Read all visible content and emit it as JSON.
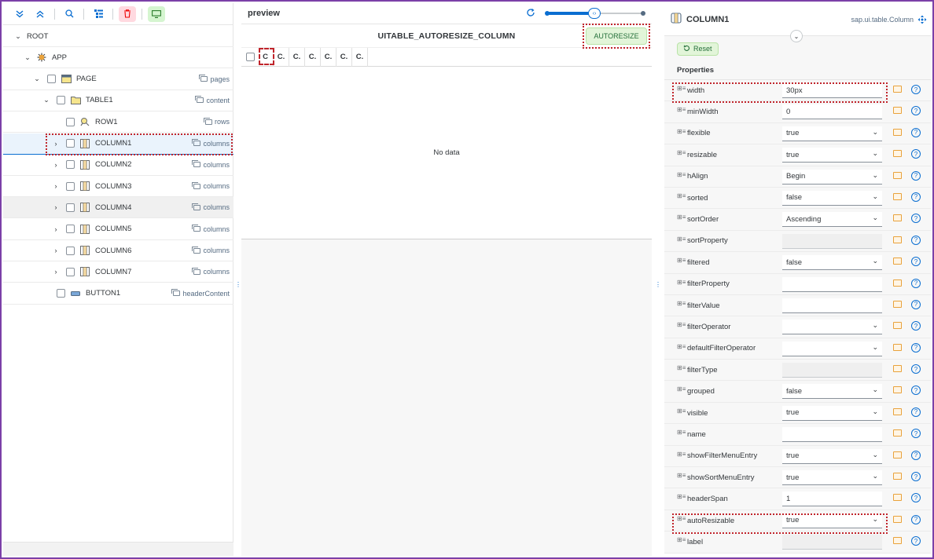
{
  "toolbar": {
    "expand_all_icon": "double-chevron-down-icon",
    "collapse_all_icon": "double-chevron-up-icon",
    "search_icon": "search-icon",
    "tree_icon": "tree-list-icon",
    "delete_icon": "trash-icon",
    "display_icon": "display-icon"
  },
  "tree": [
    {
      "label": "ROOT",
      "agg": "",
      "indent": 0,
      "chevron": "⌄",
      "checkbox": false,
      "icon": "none"
    },
    {
      "label": "APP",
      "agg": "",
      "indent": 1,
      "chevron": "⌄",
      "checkbox": false,
      "icon": "app"
    },
    {
      "label": "PAGE",
      "agg": "pages",
      "indent": 2,
      "chevron": "⌄",
      "checkbox": true,
      "icon": "page"
    },
    {
      "label": "TABLE1",
      "agg": "content",
      "indent": 3,
      "chevron": "⌄",
      "checkbox": true,
      "icon": "folder"
    },
    {
      "label": "ROW1",
      "agg": "rows",
      "indent": 4,
      "chevron": "",
      "checkbox": true,
      "icon": "row"
    },
    {
      "label": "COLUMN1",
      "agg": "columns",
      "indent": 4,
      "chevron": "›",
      "checkbox": true,
      "icon": "column",
      "selected": true
    },
    {
      "label": "COLUMN2",
      "agg": "columns",
      "indent": 4,
      "chevron": "›",
      "checkbox": true,
      "icon": "column"
    },
    {
      "label": "COLUMN3",
      "agg": "columns",
      "indent": 4,
      "chevron": "›",
      "checkbox": true,
      "icon": "column"
    },
    {
      "label": "COLUMN4",
      "agg": "columns",
      "indent": 4,
      "chevron": "›",
      "checkbox": true,
      "icon": "column",
      "hover": true
    },
    {
      "label": "COLUMN5",
      "agg": "columns",
      "indent": 4,
      "chevron": "›",
      "checkbox": true,
      "icon": "column"
    },
    {
      "label": "COLUMN6",
      "agg": "columns",
      "indent": 4,
      "chevron": "›",
      "checkbox": true,
      "icon": "column"
    },
    {
      "label": "COLUMN7",
      "agg": "columns",
      "indent": 4,
      "chevron": "›",
      "checkbox": true,
      "icon": "column"
    },
    {
      "label": "BUTTON1",
      "agg": "headerContent",
      "indent": 3,
      "chevron": "",
      "checkbox": true,
      "icon": "button"
    }
  ],
  "preview": {
    "title": "preview",
    "table_title": "UITABLE_AUTORESIZE_COLUMN",
    "autoresize_label": "AUTORESIZE",
    "columns": [
      "C",
      "C.",
      "C.",
      "C.",
      "C.",
      "C.",
      "C."
    ],
    "no_data": "No data"
  },
  "inspector": {
    "title": "COLUMN1",
    "class_name": "sap.ui.table.Column",
    "reset_label": "Reset",
    "section_title": "Properties",
    "properties": [
      {
        "name": "width",
        "value": "30px",
        "type": "input"
      },
      {
        "name": "minWidth",
        "value": "0",
        "type": "input"
      },
      {
        "name": "flexible",
        "value": "true",
        "type": "select"
      },
      {
        "name": "resizable",
        "value": "true",
        "type": "select"
      },
      {
        "name": "hAlign",
        "value": "Begin",
        "type": "select"
      },
      {
        "name": "sorted",
        "value": "false",
        "type": "select"
      },
      {
        "name": "sortOrder",
        "value": "Ascending",
        "type": "select"
      },
      {
        "name": "sortProperty",
        "value": "",
        "type": "readonly"
      },
      {
        "name": "filtered",
        "value": "false",
        "type": "select"
      },
      {
        "name": "filterProperty",
        "value": "",
        "type": "input"
      },
      {
        "name": "filterValue",
        "value": "",
        "type": "input"
      },
      {
        "name": "filterOperator",
        "value": "",
        "type": "select"
      },
      {
        "name": "defaultFilterOperator",
        "value": "",
        "type": "select"
      },
      {
        "name": "filterType",
        "value": "",
        "type": "readonly"
      },
      {
        "name": "grouped",
        "value": "false",
        "type": "select"
      },
      {
        "name": "visible",
        "value": "true",
        "type": "select"
      },
      {
        "name": "name",
        "value": "",
        "type": "input"
      },
      {
        "name": "showFilterMenuEntry",
        "value": "true",
        "type": "select"
      },
      {
        "name": "showSortMenuEntry",
        "value": "true",
        "type": "select"
      },
      {
        "name": "headerSpan",
        "value": "1",
        "type": "input"
      },
      {
        "name": "autoResizable",
        "value": "true",
        "type": "select"
      },
      {
        "name": "label",
        "value": "",
        "type": "readonly"
      }
    ]
  },
  "colors": {
    "accent": "#0a6ed1",
    "highlight": "#c0242b",
    "frame": "#7b3fa8",
    "button_green_bg": "#e2f5d9"
  }
}
